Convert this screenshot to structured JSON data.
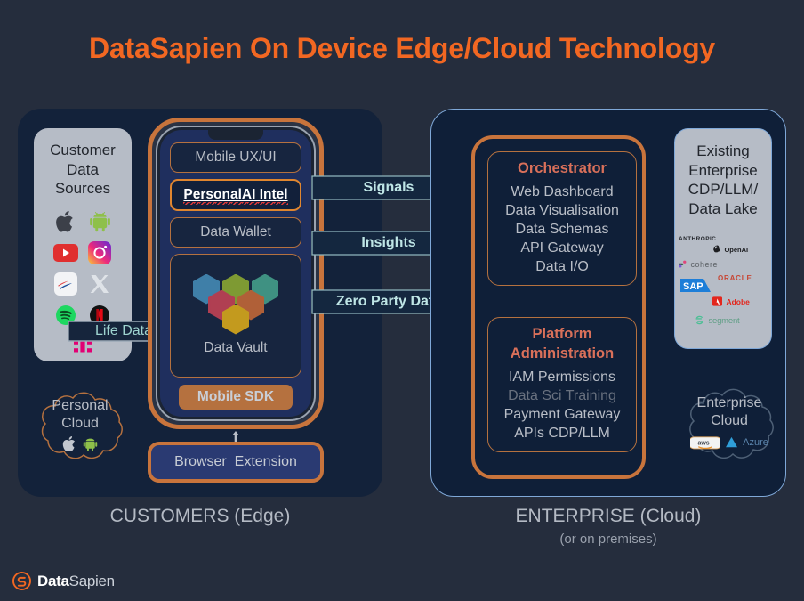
{
  "title": "DataSapien On Device Edge/Cloud Technology",
  "colors": {
    "background": "#252d3d",
    "panel": "#13223a",
    "accent_orange": "#f26722",
    "frame_copper": "#c8743c",
    "heading_salmon": "#d9705a",
    "body_gray": "#b9bec7",
    "arrow_cyan": "#bfe6e6",
    "gray_panel": "#b6bcc6",
    "enterprise_border": "#7fa8d8"
  },
  "customers": {
    "caption": "CUSTOMERS (Edge)",
    "data_sources": {
      "heading_lines": [
        "Customer",
        "Data",
        "Sources"
      ],
      "brands": [
        "apple",
        "android",
        "youtube",
        "instagram",
        "bank-of-america",
        "x-twitter",
        "spotify",
        "netflix",
        "t-mobile"
      ]
    },
    "life_data_arrow": "Life Data",
    "phone": {
      "rows": [
        {
          "label": "Mobile UX/UI",
          "highlight": false
        },
        {
          "label": "PersonalAI Intel",
          "highlight": true
        },
        {
          "label": "Data Wallet",
          "highlight": false
        }
      ],
      "vault_label": "Data Vault",
      "vault_hex_colors": [
        "#3f7fa8",
        "#7e9a33",
        "#3f9182",
        "#b03f52",
        "#b06038",
        "#c39a1e"
      ],
      "sdk_label": "Mobile SDK"
    },
    "browser_extension": "Browser  Extension",
    "personal_cloud": {
      "lines": [
        "Personal",
        "Cloud"
      ],
      "logos": [
        "apple",
        "android"
      ]
    }
  },
  "flows": [
    {
      "label": "Signals"
    },
    {
      "label": "Insights"
    },
    {
      "label": "Zero Party Data"
    }
  ],
  "enterprise": {
    "caption": "ENTERPRISE (Cloud)",
    "caption_sub": "(or on premises)",
    "orchestrator": {
      "title": "Orchestrator",
      "items": [
        "Web Dashboard",
        "Data Visualisation",
        "Data Schemas",
        "API Gateway",
        "Data I/O"
      ]
    },
    "platform_administration": {
      "title_lines": [
        "Platform",
        "Administration"
      ],
      "items": [
        {
          "label": "IAM Permissions",
          "dim": false
        },
        {
          "label": "Data Sci Training",
          "dim": true
        },
        {
          "label": "Payment Gateway",
          "dim": false
        },
        {
          "label": "APIs CDP/LLM",
          "dim": false
        }
      ]
    },
    "existing": {
      "heading_lines": [
        "Existing",
        "Enterprise",
        "CDP/LLM/",
        "Data Lake"
      ],
      "vendors": [
        "ANTHROPIC",
        "OpenAI",
        "cohere",
        "ORACLE",
        "SAP",
        "Adobe",
        "segment"
      ]
    },
    "enterprise_cloud": {
      "lines": [
        "Enterprise",
        "Cloud"
      ],
      "logos": [
        "aws",
        "azure"
      ]
    }
  },
  "brand": {
    "name_bold": "Data",
    "name_light": "Sapien"
  }
}
